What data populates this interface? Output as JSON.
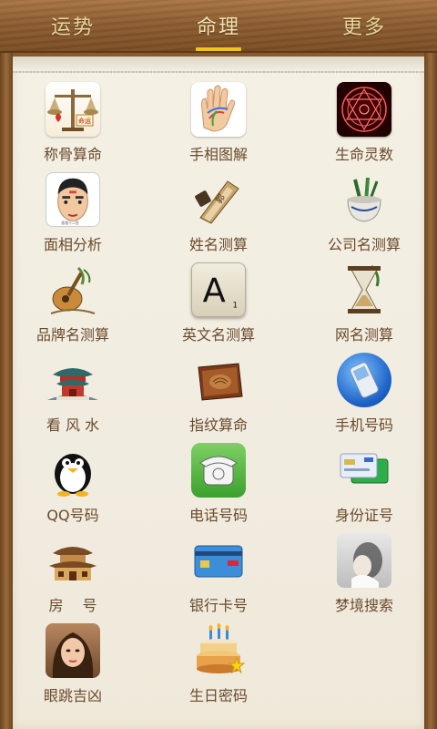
{
  "tabs": [
    {
      "label": "运势",
      "active": false
    },
    {
      "label": "命理",
      "active": true
    },
    {
      "label": "更多",
      "active": false
    }
  ],
  "grid": [
    {
      "label": "称骨算命",
      "icon": "scale-icon"
    },
    {
      "label": "手相图解",
      "icon": "palm-icon"
    },
    {
      "label": "生命灵数",
      "icon": "magic-circle-icon"
    },
    {
      "label": "面相分析",
      "icon": "face-icon"
    },
    {
      "label": "姓名测算",
      "icon": "name-seal-icon"
    },
    {
      "label": "公司名测算",
      "icon": "pot-icon"
    },
    {
      "label": "品牌名测算",
      "icon": "pipa-icon"
    },
    {
      "label": "英文名测算",
      "icon": "letter-a-icon"
    },
    {
      "label": "网名测算",
      "icon": "hourglass-icon"
    },
    {
      "label": "看 风 水",
      "icon": "pavilion-icon"
    },
    {
      "label": "指纹算命",
      "icon": "book-icon"
    },
    {
      "label": "手机号码",
      "icon": "mobile-phone-icon"
    },
    {
      "label": "QQ号码",
      "icon": "penguin-icon"
    },
    {
      "label": "电话号码",
      "icon": "telephone-icon"
    },
    {
      "label": "身份证号",
      "icon": "id-card-icon"
    },
    {
      "label": "房　 号",
      "icon": "house-icon"
    },
    {
      "label": "银行卡号",
      "icon": "bank-card-icon"
    },
    {
      "label": "梦境搜索",
      "icon": "dream-icon"
    },
    {
      "label": "眼跳吉凶",
      "icon": "eye-portrait-icon"
    },
    {
      "label": "生日密码",
      "icon": "birthday-cake-icon"
    }
  ],
  "colors": {
    "label": "#6b4a2c",
    "tab_text": "#ead49a",
    "tab_indicator": "#f3c315"
  }
}
